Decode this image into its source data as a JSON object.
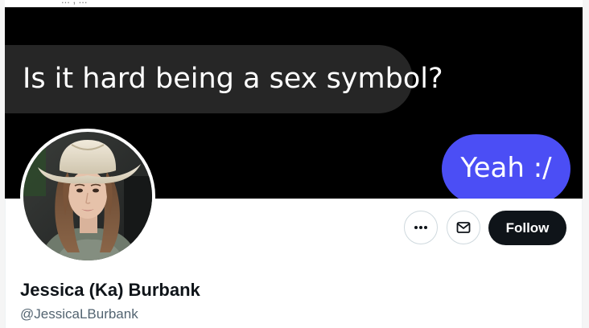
{
  "top_strip": {
    "partial_text": "...  ,  ..."
  },
  "banner": {
    "incoming_message": "Is it hard being a sex symbol?",
    "outgoing_message": "Yeah :/",
    "incoming_bubble_color": "#262626",
    "outgoing_bubble_color": "#4b4ef5",
    "background_color": "#000000"
  },
  "profile": {
    "display_name": "Jessica (Ka) Burbank",
    "handle": "@JessicaLBurbank",
    "avatar_icon": "profile-photo"
  },
  "actions": {
    "more_icon": "more-horizontal-icon",
    "message_icon": "envelope-icon",
    "follow_label": "Follow",
    "follow_bg": "#0f1419"
  }
}
